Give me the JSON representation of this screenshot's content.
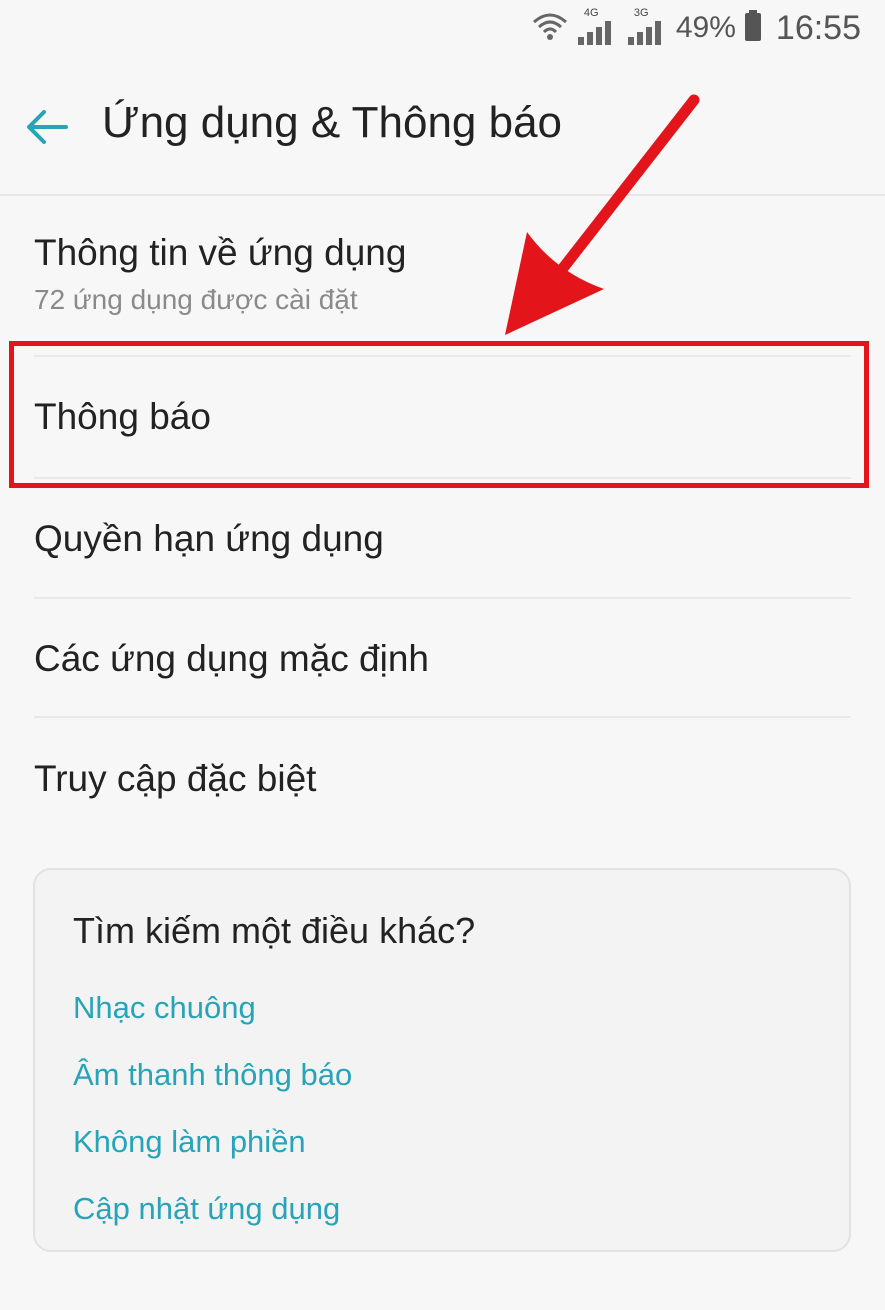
{
  "status": {
    "network_tag_1": "4G",
    "network_tag_2": "3G",
    "battery": "49%",
    "time": "16:55"
  },
  "header": {
    "title": "Ứng dụng & Thông báo"
  },
  "items": [
    {
      "label": "Thông tin về ứng dụng",
      "sub": "72 ứng dụng được cài đặt"
    },
    {
      "label": "Thông báo"
    },
    {
      "label": "Quyền hạn ứng dụng"
    },
    {
      "label": "Các ứng dụng mặc định"
    },
    {
      "label": "Truy cập đặc biệt"
    }
  ],
  "suggest": {
    "heading": "Tìm kiếm một điều khác?",
    "links": [
      "Nhạc chuông",
      "Âm thanh thông báo",
      "Không làm phiền",
      "Cập nhật ứng dụng"
    ]
  },
  "colors": {
    "accent": "#27a4b8",
    "highlight": "#e4141b"
  }
}
